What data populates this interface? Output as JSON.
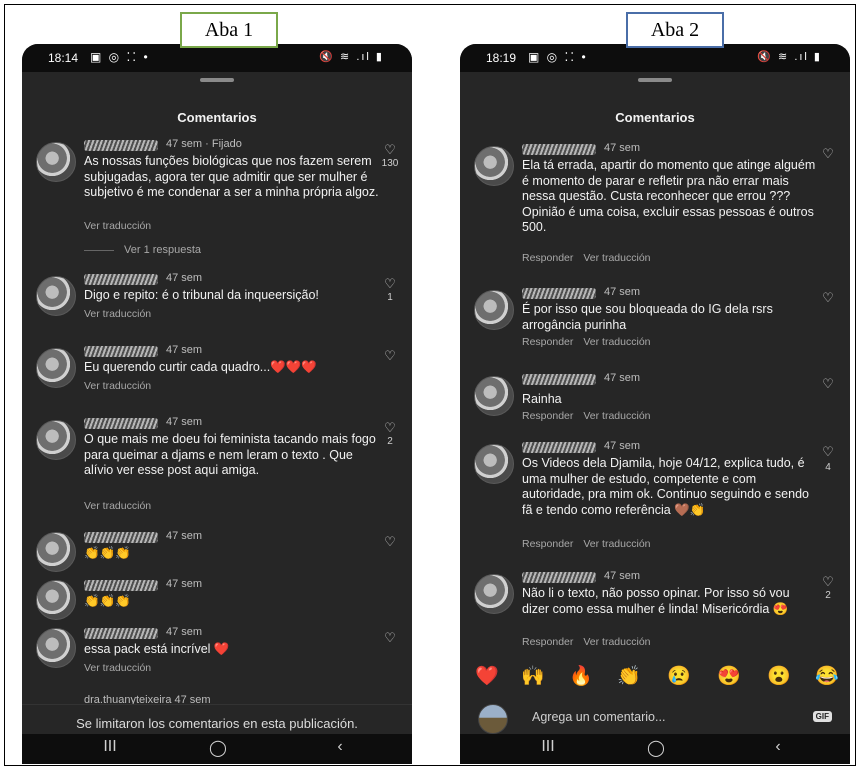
{
  "tab1_label": "Aba 1",
  "tab2_label": "Aba 2",
  "phone1": {
    "time": "18:14",
    "status_left": "▣ ◎ ⁚⁚ •",
    "status_right": "🔇 ≋ .ıl ▮",
    "title": "Comentarios",
    "comments": [
      {
        "meta": "47 sem · Fijado",
        "text": "As nossas funções biológicas que nos fazem serem subjugadas, agora ter que admitir que ser mulher é subjetivo é me condenar a ser a minha própria algoz.",
        "actions": [
          "Ver traducción"
        ],
        "likes": "130",
        "replies": "Ver 1 respuesta"
      },
      {
        "meta": "47 sem",
        "text": "Digo e repito: é o tribunal da inqueersição!",
        "actions": [
          "Ver traducción"
        ],
        "likes": "1"
      },
      {
        "meta": "47 sem",
        "text": "Eu querendo curtir cada quadro...❤️❤️❤️",
        "actions": [
          "Ver traducción"
        ],
        "likes": ""
      },
      {
        "meta": "47 sem",
        "text": "O que mais me doeu foi feminista tacando mais fogo para queimar a djams e nem leram o texto . Que alívio ver esse post aqui amiga.",
        "actions": [
          "Ver traducción"
        ],
        "likes": "2"
      },
      {
        "meta": "47 sem",
        "text": "👏👏👏",
        "actions": [],
        "likes": ""
      },
      {
        "meta": "47 sem",
        "text": "👏👏👏",
        "actions": [],
        "likes": ""
      },
      {
        "meta": "47 sem",
        "text": "essa pack está incrível ❤️",
        "actions": [
          "Ver traducción"
        ],
        "likes": ""
      },
      {
        "meta": "dra.thuanyteixeira 47 sem",
        "text": "",
        "actions": [],
        "likes": ""
      }
    ],
    "limit_notice": "Se limitaron los comentarios en esta publicación.",
    "nav": [
      "III",
      "◯",
      "‹"
    ]
  },
  "phone2": {
    "time": "18:19",
    "status_left": "▣ ◎ ⁚⁚ •",
    "status_right": "🔇 ≋ .ıl ▮",
    "title": "Comentarios",
    "comments": [
      {
        "meta": "47 sem",
        "text": "Ela tá errada, apartir do momento que atinge alguém é momento de parar e refletir pra não errar mais nessa questão. Custa reconhecer que errou ??? Opinião é uma coisa, excluir essas pessoas é outros 500.",
        "actions": [
          "Responder",
          "Ver traducción"
        ],
        "likes": ""
      },
      {
        "meta": "47 sem",
        "text": "É por isso que sou bloqueada do IG dela rsrs arrogância purinha",
        "actions": [
          "Responder",
          "Ver traducción"
        ],
        "likes": ""
      },
      {
        "meta": "47 sem",
        "text": "Rainha",
        "actions": [
          "Responder",
          "Ver traducción"
        ],
        "likes": ""
      },
      {
        "meta": "47 sem",
        "text": "Os Videos dela Djamila, hoje 04/12, explica tudo, é uma mulher de estudo, competente e com autoridade, pra mim ok. Continuo seguindo e sendo fã e tendo como referência 🤎👏",
        "actions": [
          "Responder",
          "Ver traducción"
        ],
        "likes": "4"
      },
      {
        "meta": "47 sem",
        "text": "Não li o texto, não posso opinar. Por isso só vou dizer como essa mulher é linda! Misericórdia 😍",
        "actions": [
          "Responder",
          "Ver traducción"
        ],
        "likes": "2"
      }
    ],
    "emojis": [
      "❤️",
      "🙌",
      "🔥",
      "👏",
      "😢",
      "😍",
      "😮",
      "😂"
    ],
    "compose_placeholder": "Agrega un comentario...",
    "gif_label": "GIF",
    "nav": [
      "III",
      "◯",
      "‹"
    ]
  }
}
